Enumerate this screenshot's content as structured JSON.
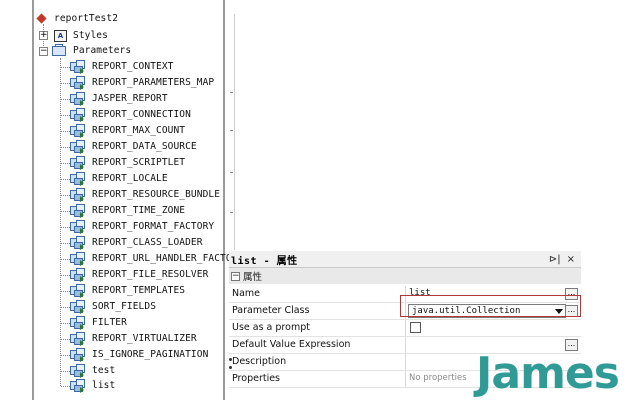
{
  "tree": {
    "root": "reportTest2",
    "styles": "Styles",
    "styles_icon_text": "A",
    "parameters": "Parameters",
    "expander_collapsed": "+",
    "expander_expanded": "−",
    "items": [
      "REPORT_CONTEXT",
      "REPORT_PARAMETERS_MAP",
      "JASPER_REPORT",
      "REPORT_CONNECTION",
      "REPORT_MAX_COUNT",
      "REPORT_DATA_SOURCE",
      "REPORT_SCRIPTLET",
      "REPORT_LOCALE",
      "REPORT_RESOURCE_BUNDLE",
      "REPORT_TIME_ZONE",
      "REPORT_FORMAT_FACTORY",
      "REPORT_CLASS_LOADER",
      "REPORT_URL_HANDLER_FACTOR",
      "REPORT_FILE_RESOLVER",
      "REPORT_TEMPLATES",
      "SORT_FIELDS",
      "FILTER",
      "REPORT_VIRTUALIZER",
      "IS_IGNORE_PAGINATION",
      "test",
      "list"
    ]
  },
  "properties": {
    "title": "list - 属性",
    "pin_icon": "⊳|",
    "close_icon": "×",
    "section": "属性",
    "section_toggle": "−",
    "ellipsis": "...",
    "rows": [
      {
        "key": "Name",
        "value": "list"
      },
      {
        "key": "Parameter Class",
        "value": "java.util.Collection"
      },
      {
        "key": "Use as a prompt",
        "value": ""
      },
      {
        "key": "Default Value Expression",
        "value": ""
      },
      {
        "key": "Description",
        "value": ""
      },
      {
        "key": "Properties",
        "value": "No properties"
      }
    ]
  },
  "logo": {
    "text": "James"
  },
  "colors": {
    "logo": "#2f9a96",
    "highlight": "#b03a3a"
  }
}
